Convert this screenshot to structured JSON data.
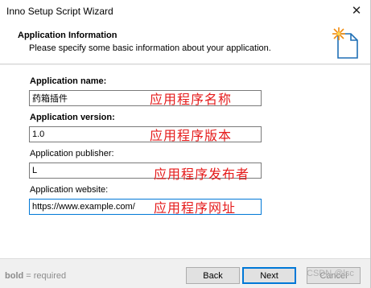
{
  "window": {
    "title": "Inno Setup Script Wizard",
    "close_glyph": "✕"
  },
  "header": {
    "title": "Application Information",
    "subtitle": "Please specify some basic information about your application.",
    "icon": "wizard-page-icon"
  },
  "fields": {
    "name": {
      "label": "Application name:",
      "value": "药箱插件",
      "annotation": "应用程序名称"
    },
    "version": {
      "label": "Application version:",
      "value": "1.0",
      "annotation": "应用程序版本"
    },
    "publisher": {
      "label": "Application publisher:",
      "value": "L",
      "annotation": "应用程序发布者"
    },
    "website": {
      "label": "Application website:",
      "value": "https://www.example.com/",
      "annotation": "应用程序网址"
    }
  },
  "footer": {
    "hint_bold": "bold",
    "hint_rest": " = required",
    "back_label": "Back",
    "next_label": "Next",
    "cancel_label": "Cancel",
    "watermark": "CSDN @lsc"
  },
  "colors": {
    "annotation": "#e51b1b",
    "focus": "#0078d7"
  }
}
